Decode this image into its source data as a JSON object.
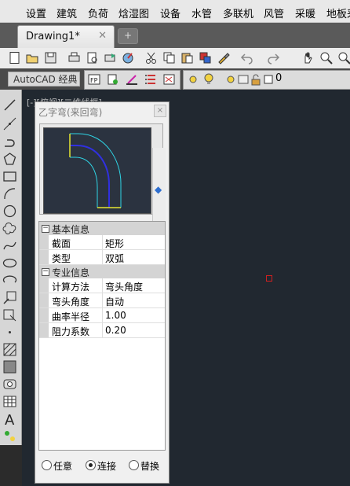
{
  "menubar": {
    "items": [
      "设置",
      "建筑",
      "负荷",
      "焓湿图",
      "设备",
      "水管",
      "多联机",
      "风管",
      "采暖",
      "地板采"
    ]
  },
  "tabs": {
    "document": "Drawing1*",
    "close_glyph": "✕",
    "new_tab_glyph": "+"
  },
  "toolbar2": {
    "workspace": "AutoCAD 经典",
    "layer_value": "0"
  },
  "canvas": {
    "view_label": "[-][俯视][二维线框]"
  },
  "dialog": {
    "title": "乙字弯(来回弯)",
    "close_glyph": "×",
    "pick_glyph": "◆",
    "categories": [
      {
        "label": "基本信息",
        "toggle": "−",
        "rows": [
          {
            "key": "截面",
            "value": "矩形"
          },
          {
            "key": "类型",
            "value": "双弧"
          }
        ]
      },
      {
        "label": "专业信息",
        "toggle": "−",
        "rows": [
          {
            "key": "计算方法",
            "value": "弯头角度"
          },
          {
            "key": "弯头角度",
            "value": "自动"
          },
          {
            "key": "曲率半径",
            "value": "1.00"
          },
          {
            "key": "阻力系数",
            "value": "0.20"
          }
        ]
      }
    ],
    "radios": [
      {
        "label": "任意",
        "selected": false
      },
      {
        "label": "连接",
        "selected": true
      },
      {
        "label": "替换",
        "selected": false
      }
    ]
  },
  "colors": {
    "preview_bg": "#2b3340",
    "duct_outline": "#2fd6e6",
    "duct_center": "#3030e0",
    "duct_ends": "#e6e630",
    "canvas_bg": "#212830"
  }
}
